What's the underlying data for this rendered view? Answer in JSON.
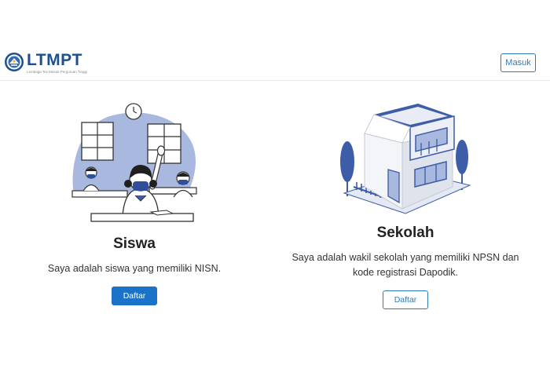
{
  "header": {
    "brand_name": "LTMPT",
    "brand_tagline": "Lembaga Tes Masuk Perguruan Tinggi",
    "login_label": "Masuk"
  },
  "student_card": {
    "title": "Siswa",
    "description": "Saya adalah siswa yang memiliki NISN.",
    "button_label": "Daftar"
  },
  "school_card": {
    "title": "Sekolah",
    "description": "Saya adalah wakil sekolah yang memiliki NPSN dan kode registrasi Dapodik.",
    "button_label": "Daftar"
  },
  "colors": {
    "brand": "#1d4f91",
    "accent": "#1a73c9",
    "illustration_blue": "#3d5da8",
    "illustration_light": "#a9b8df"
  }
}
